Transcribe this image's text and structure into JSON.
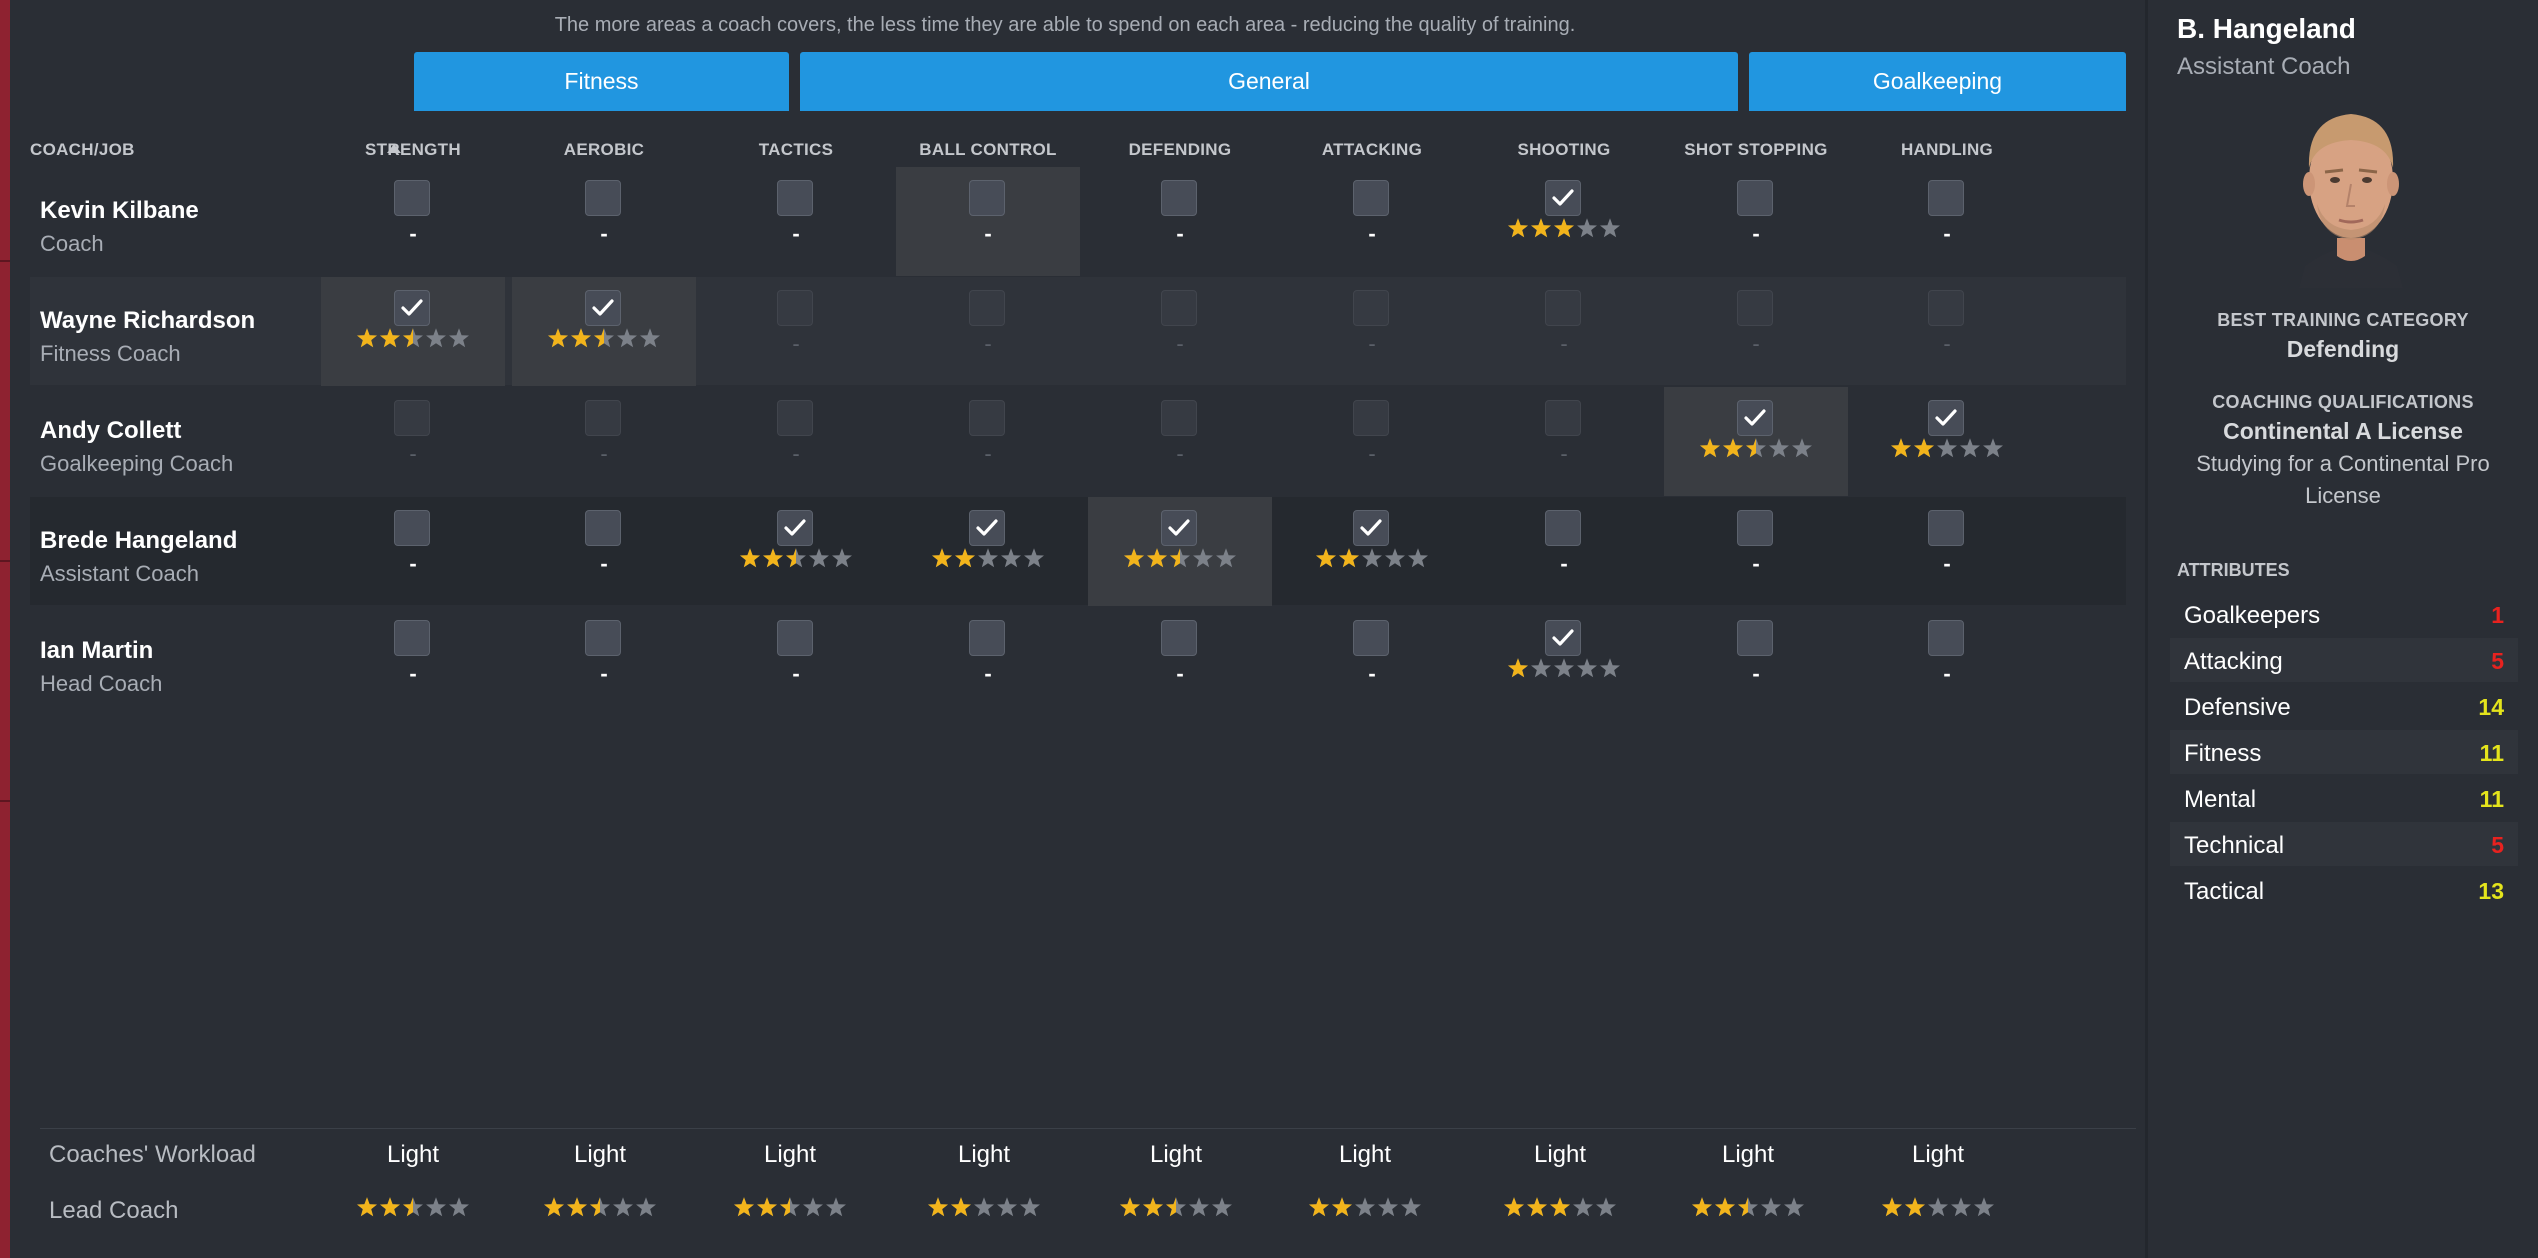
{
  "notice": "The more areas a coach covers, the less time they are able to spend on each area - reducing the quality of training.",
  "groups": {
    "fitness": "Fitness",
    "general": "General",
    "goalkeeping": "Goalkeeping"
  },
  "columns": {
    "coach_job": "COACH/JOB",
    "areas": [
      "STRENGTH",
      "AEROBIC",
      "TACTICS",
      "BALL CONTROL",
      "DEFENDING",
      "ATTACKING",
      "SHOOTING",
      "SHOT STOPPING",
      "HANDLING"
    ]
  },
  "coaches": [
    {
      "name": "Kevin Kilbane",
      "job": "Coach",
      "cells": [
        {
          "checked": false,
          "enabled": true,
          "rating": null,
          "dash": "-"
        },
        {
          "checked": false,
          "enabled": true,
          "rating": null,
          "dash": "-"
        },
        {
          "checked": false,
          "enabled": true,
          "rating": null,
          "dash": "-"
        },
        {
          "checked": false,
          "enabled": true,
          "rating": null,
          "dash": "-"
        },
        {
          "checked": false,
          "enabled": true,
          "rating": null,
          "dash": "-"
        },
        {
          "checked": false,
          "enabled": true,
          "rating": null,
          "dash": "-"
        },
        {
          "checked": true,
          "enabled": true,
          "rating": 3,
          "dash": ""
        },
        {
          "checked": false,
          "enabled": true,
          "rating": null,
          "dash": "-"
        },
        {
          "checked": false,
          "enabled": true,
          "rating": null,
          "dash": "-"
        }
      ]
    },
    {
      "name": "Wayne Richardson",
      "job": "Fitness Coach",
      "cells": [
        {
          "checked": true,
          "enabled": true,
          "rating": 2.5,
          "dash": ""
        },
        {
          "checked": true,
          "enabled": true,
          "rating": 2.5,
          "dash": ""
        },
        {
          "checked": false,
          "enabled": false,
          "rating": null,
          "dash": "-"
        },
        {
          "checked": false,
          "enabled": false,
          "rating": null,
          "dash": "-"
        },
        {
          "checked": false,
          "enabled": false,
          "rating": null,
          "dash": "-"
        },
        {
          "checked": false,
          "enabled": false,
          "rating": null,
          "dash": "-"
        },
        {
          "checked": false,
          "enabled": false,
          "rating": null,
          "dash": "-"
        },
        {
          "checked": false,
          "enabled": false,
          "rating": null,
          "dash": "-"
        },
        {
          "checked": false,
          "enabled": false,
          "rating": null,
          "dash": "-"
        }
      ]
    },
    {
      "name": "Andy Collett",
      "job": "Goalkeeping Coach",
      "cells": [
        {
          "checked": false,
          "enabled": false,
          "rating": null,
          "dash": "-"
        },
        {
          "checked": false,
          "enabled": false,
          "rating": null,
          "dash": "-"
        },
        {
          "checked": false,
          "enabled": false,
          "rating": null,
          "dash": "-"
        },
        {
          "checked": false,
          "enabled": false,
          "rating": null,
          "dash": "-"
        },
        {
          "checked": false,
          "enabled": false,
          "rating": null,
          "dash": "-"
        },
        {
          "checked": false,
          "enabled": false,
          "rating": null,
          "dash": "-"
        },
        {
          "checked": false,
          "enabled": false,
          "rating": null,
          "dash": "-"
        },
        {
          "checked": true,
          "enabled": true,
          "rating": 2.5,
          "dash": ""
        },
        {
          "checked": true,
          "enabled": true,
          "rating": 2,
          "dash": ""
        }
      ]
    },
    {
      "name": "Brede Hangeland",
      "job": "Assistant Coach",
      "cells": [
        {
          "checked": false,
          "enabled": true,
          "rating": null,
          "dash": "-"
        },
        {
          "checked": false,
          "enabled": true,
          "rating": null,
          "dash": "-"
        },
        {
          "checked": true,
          "enabled": true,
          "rating": 2.5,
          "dash": ""
        },
        {
          "checked": true,
          "enabled": true,
          "rating": 2,
          "dash": ""
        },
        {
          "checked": true,
          "enabled": true,
          "rating": 2.5,
          "dash": ""
        },
        {
          "checked": true,
          "enabled": true,
          "rating": 2,
          "dash": ""
        },
        {
          "checked": false,
          "enabled": true,
          "rating": null,
          "dash": "-"
        },
        {
          "checked": false,
          "enabled": true,
          "rating": null,
          "dash": "-"
        },
        {
          "checked": false,
          "enabled": true,
          "rating": null,
          "dash": "-"
        }
      ]
    },
    {
      "name": "Ian Martin",
      "job": "Head Coach",
      "cells": [
        {
          "checked": false,
          "enabled": true,
          "rating": null,
          "dash": "-"
        },
        {
          "checked": false,
          "enabled": true,
          "rating": null,
          "dash": "-"
        },
        {
          "checked": false,
          "enabled": true,
          "rating": null,
          "dash": "-"
        },
        {
          "checked": false,
          "enabled": true,
          "rating": null,
          "dash": "-"
        },
        {
          "checked": false,
          "enabled": true,
          "rating": null,
          "dash": "-"
        },
        {
          "checked": false,
          "enabled": true,
          "rating": null,
          "dash": "-"
        },
        {
          "checked": true,
          "enabled": true,
          "rating": 1,
          "dash": ""
        },
        {
          "checked": false,
          "enabled": true,
          "rating": null,
          "dash": "-"
        },
        {
          "checked": false,
          "enabled": true,
          "rating": null,
          "dash": "-"
        }
      ]
    }
  ],
  "footer": {
    "workload_label": "Coaches' Workload",
    "workload": [
      "Light",
      "Light",
      "Light",
      "Light",
      "Light",
      "Light",
      "Light",
      "Light",
      "Light"
    ],
    "lead_label": "Lead Coach",
    "lead_ratings": [
      2.5,
      2.5,
      2.5,
      2,
      2.5,
      2,
      3,
      2.5,
      2
    ]
  },
  "profile": {
    "name": "B. Hangeland",
    "role": "Assistant Coach",
    "best_category_label": "BEST TRAINING CATEGORY",
    "best_category": "Defending",
    "qualifications_label": "COACHING QUALIFICATIONS",
    "qualification": "Continental A License",
    "studying": "Studying for a Continental Pro License",
    "attributes_label": "ATTRIBUTES",
    "attributes": [
      {
        "name": "Goalkeepers",
        "value": "1",
        "color": "#e8221f"
      },
      {
        "name": "Attacking",
        "value": "5",
        "color": "#e8221f"
      },
      {
        "name": "Defensive",
        "value": "14",
        "color": "#e4e41c"
      },
      {
        "name": "Fitness",
        "value": "11",
        "color": "#e4e41c"
      },
      {
        "name": "Mental",
        "value": "11",
        "color": "#e4e41c"
      },
      {
        "name": "Technical",
        "value": "5",
        "color": "#e8221f"
      },
      {
        "name": "Tactical",
        "value": "13",
        "color": "#e4e41c"
      }
    ]
  },
  "colors": {
    "accent": "#2196e0",
    "star_on": "#f2b41b",
    "star_off": "#7c8189"
  }
}
